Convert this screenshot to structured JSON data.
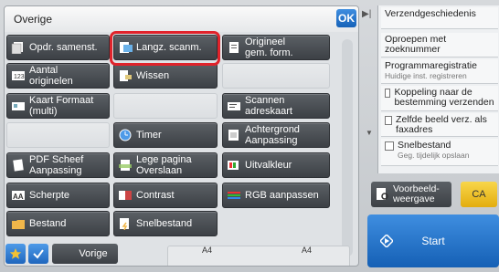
{
  "header": {
    "title": "Overige",
    "ok_label": "OK"
  },
  "buttons": [
    {
      "name": "opdr-samenst-button",
      "label": "Opdr. samenst.",
      "icon": "stack-icon",
      "disabled": false
    },
    {
      "name": "langz-scanm-button",
      "label": "Langz. scanm.",
      "icon": "scan-icon",
      "disabled": false
    },
    {
      "name": "origineel-gem-form-button",
      "label": "Origineel\ngem. form.",
      "icon": "document-icon",
      "disabled": false
    },
    {
      "name": "aantal-originelen-button",
      "label": "Aantal\noriginelen",
      "icon": "counter-icon",
      "disabled": false
    },
    {
      "name": "wissen-button",
      "label": "Wissen",
      "icon": "eraser-icon",
      "disabled": false
    },
    {
      "name": "empty-slot-1",
      "label": "",
      "icon": "",
      "disabled": true
    },
    {
      "name": "kaart-formaat-button",
      "label": "Kaart Formaat\n(multi)",
      "icon": "card-icon",
      "disabled": false
    },
    {
      "name": "empty-slot-2",
      "label": "",
      "icon": "",
      "disabled": true
    },
    {
      "name": "scannen-adreskaart-button",
      "label": "Scannen\nadreskaart",
      "icon": "address-card-icon",
      "disabled": false
    },
    {
      "name": "empty-slot-3",
      "label": "",
      "icon": "",
      "disabled": true
    },
    {
      "name": "timer-button",
      "label": "Timer",
      "icon": "clock-icon",
      "disabled": false
    },
    {
      "name": "achtergrond-aanpassing-button",
      "label": "Achtergrond\nAanpassing",
      "icon": "background-icon",
      "disabled": false
    },
    {
      "name": "pdf-scheef-aanpassing-button",
      "label": "PDF Scheef\nAanpassing",
      "icon": "pdf-icon",
      "disabled": false
    },
    {
      "name": "lege-pagina-overslaan-button",
      "label": "Lege pagina\nOverslaan",
      "icon": "blank-page-icon",
      "disabled": false
    },
    {
      "name": "uitvalkleur-button",
      "label": "Uitvalkleur",
      "icon": "color-icon",
      "disabled": false
    },
    {
      "name": "scherpte-button",
      "label": "Scherpte",
      "icon": "sharpness-icon",
      "disabled": false
    },
    {
      "name": "contrast-button",
      "label": "Contrast",
      "icon": "contrast-icon",
      "disabled": false
    },
    {
      "name": "rgb-aanpassen-button",
      "label": "RGB aanpassen",
      "icon": "rgb-icon",
      "disabled": false
    },
    {
      "name": "bestand-button",
      "label": "Bestand",
      "icon": "folder-icon",
      "disabled": false
    },
    {
      "name": "snelbestand-button",
      "label": "Snelbestand",
      "icon": "quick-file-icon",
      "disabled": false
    }
  ],
  "footer": {
    "vorige_label": "Vorige",
    "a4_left": "A4",
    "a4_right": "A4"
  },
  "right_panel": {
    "items": [
      {
        "label": "Verzendgeschiedenis",
        "sub": "",
        "checkbox": false
      },
      {
        "label": "Oproepen met zoeknummer",
        "sub": "",
        "checkbox": false
      },
      {
        "label": "Programmaregistratie",
        "sub": "Huidige inst. registreren",
        "checkbox": false
      },
      {
        "label": "Koppeling naar de bestemming verzenden",
        "sub": "",
        "checkbox": true
      },
      {
        "label": "Zelfde beeld verz. als faxadres",
        "sub": "",
        "checkbox": true
      },
      {
        "label": "Snelbestand",
        "sub": "Geg. tijdelijk opslaan",
        "checkbox": true
      }
    ]
  },
  "preview_label": "Voorbeeld-\nweergave",
  "ca_label": "CA",
  "start_label": "Start",
  "colors": {
    "accent": "#1f66bd",
    "highlight": "#e0232b",
    "ca": "#f1c12c"
  }
}
